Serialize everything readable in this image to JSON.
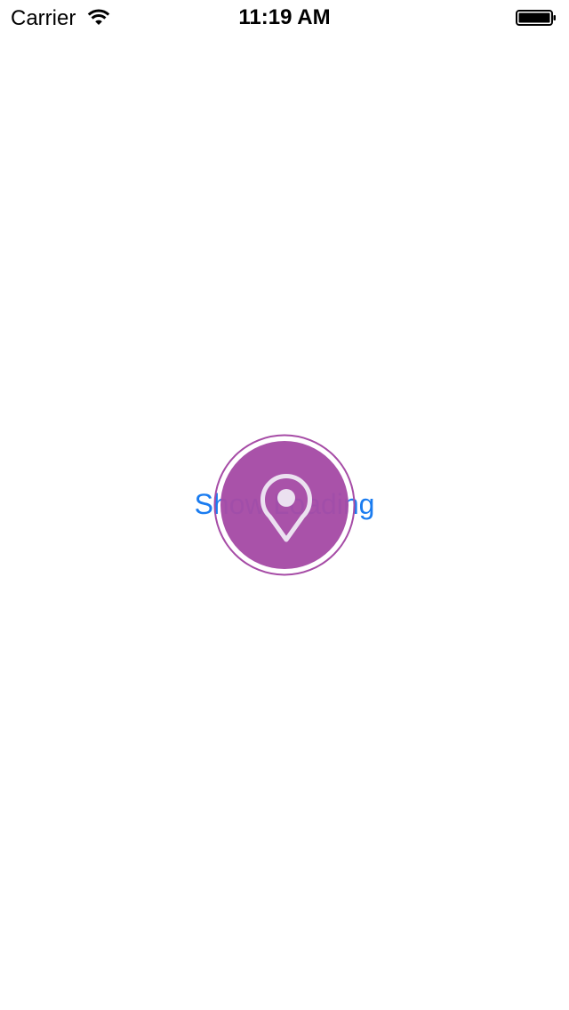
{
  "status_bar": {
    "carrier": "Carrier",
    "time": "11:19 AM",
    "wifi_icon": "wifi-icon",
    "battery_icon": "battery-icon"
  },
  "main": {
    "button_label": "Show Loading",
    "loader_icon": "map-pin-icon",
    "colors": {
      "accent": "#a64ca6",
      "link": "#1a7cf0",
      "pin": "#ebe1f0"
    }
  }
}
